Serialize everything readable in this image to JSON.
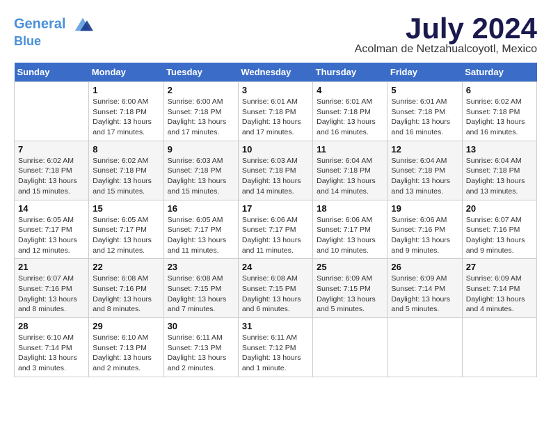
{
  "header": {
    "logo_line1": "General",
    "logo_line2": "Blue",
    "month": "July 2024",
    "location": "Acolman de Netzahualcoyotl, Mexico"
  },
  "days_of_week": [
    "Sunday",
    "Monday",
    "Tuesday",
    "Wednesday",
    "Thursday",
    "Friday",
    "Saturday"
  ],
  "weeks": [
    [
      {
        "num": "",
        "info": ""
      },
      {
        "num": "1",
        "info": "Sunrise: 6:00 AM\nSunset: 7:18 PM\nDaylight: 13 hours\nand 17 minutes."
      },
      {
        "num": "2",
        "info": "Sunrise: 6:00 AM\nSunset: 7:18 PM\nDaylight: 13 hours\nand 17 minutes."
      },
      {
        "num": "3",
        "info": "Sunrise: 6:01 AM\nSunset: 7:18 PM\nDaylight: 13 hours\nand 17 minutes."
      },
      {
        "num": "4",
        "info": "Sunrise: 6:01 AM\nSunset: 7:18 PM\nDaylight: 13 hours\nand 16 minutes."
      },
      {
        "num": "5",
        "info": "Sunrise: 6:01 AM\nSunset: 7:18 PM\nDaylight: 13 hours\nand 16 minutes."
      },
      {
        "num": "6",
        "info": "Sunrise: 6:02 AM\nSunset: 7:18 PM\nDaylight: 13 hours\nand 16 minutes."
      }
    ],
    [
      {
        "num": "7",
        "info": "Sunrise: 6:02 AM\nSunset: 7:18 PM\nDaylight: 13 hours\nand 15 minutes."
      },
      {
        "num": "8",
        "info": "Sunrise: 6:02 AM\nSunset: 7:18 PM\nDaylight: 13 hours\nand 15 minutes."
      },
      {
        "num": "9",
        "info": "Sunrise: 6:03 AM\nSunset: 7:18 PM\nDaylight: 13 hours\nand 15 minutes."
      },
      {
        "num": "10",
        "info": "Sunrise: 6:03 AM\nSunset: 7:18 PM\nDaylight: 13 hours\nand 14 minutes."
      },
      {
        "num": "11",
        "info": "Sunrise: 6:04 AM\nSunset: 7:18 PM\nDaylight: 13 hours\nand 14 minutes."
      },
      {
        "num": "12",
        "info": "Sunrise: 6:04 AM\nSunset: 7:18 PM\nDaylight: 13 hours\nand 13 minutes."
      },
      {
        "num": "13",
        "info": "Sunrise: 6:04 AM\nSunset: 7:18 PM\nDaylight: 13 hours\nand 13 minutes."
      }
    ],
    [
      {
        "num": "14",
        "info": "Sunrise: 6:05 AM\nSunset: 7:17 PM\nDaylight: 13 hours\nand 12 minutes."
      },
      {
        "num": "15",
        "info": "Sunrise: 6:05 AM\nSunset: 7:17 PM\nDaylight: 13 hours\nand 12 minutes."
      },
      {
        "num": "16",
        "info": "Sunrise: 6:05 AM\nSunset: 7:17 PM\nDaylight: 13 hours\nand 11 minutes."
      },
      {
        "num": "17",
        "info": "Sunrise: 6:06 AM\nSunset: 7:17 PM\nDaylight: 13 hours\nand 11 minutes."
      },
      {
        "num": "18",
        "info": "Sunrise: 6:06 AM\nSunset: 7:17 PM\nDaylight: 13 hours\nand 10 minutes."
      },
      {
        "num": "19",
        "info": "Sunrise: 6:06 AM\nSunset: 7:16 PM\nDaylight: 13 hours\nand 9 minutes."
      },
      {
        "num": "20",
        "info": "Sunrise: 6:07 AM\nSunset: 7:16 PM\nDaylight: 13 hours\nand 9 minutes."
      }
    ],
    [
      {
        "num": "21",
        "info": "Sunrise: 6:07 AM\nSunset: 7:16 PM\nDaylight: 13 hours\nand 8 minutes."
      },
      {
        "num": "22",
        "info": "Sunrise: 6:08 AM\nSunset: 7:16 PM\nDaylight: 13 hours\nand 8 minutes."
      },
      {
        "num": "23",
        "info": "Sunrise: 6:08 AM\nSunset: 7:15 PM\nDaylight: 13 hours\nand 7 minutes."
      },
      {
        "num": "24",
        "info": "Sunrise: 6:08 AM\nSunset: 7:15 PM\nDaylight: 13 hours\nand 6 minutes."
      },
      {
        "num": "25",
        "info": "Sunrise: 6:09 AM\nSunset: 7:15 PM\nDaylight: 13 hours\nand 5 minutes."
      },
      {
        "num": "26",
        "info": "Sunrise: 6:09 AM\nSunset: 7:14 PM\nDaylight: 13 hours\nand 5 minutes."
      },
      {
        "num": "27",
        "info": "Sunrise: 6:09 AM\nSunset: 7:14 PM\nDaylight: 13 hours\nand 4 minutes."
      }
    ],
    [
      {
        "num": "28",
        "info": "Sunrise: 6:10 AM\nSunset: 7:14 PM\nDaylight: 13 hours\nand 3 minutes."
      },
      {
        "num": "29",
        "info": "Sunrise: 6:10 AM\nSunset: 7:13 PM\nDaylight: 13 hours\nand 2 minutes."
      },
      {
        "num": "30",
        "info": "Sunrise: 6:11 AM\nSunset: 7:13 PM\nDaylight: 13 hours\nand 2 minutes."
      },
      {
        "num": "31",
        "info": "Sunrise: 6:11 AM\nSunset: 7:12 PM\nDaylight: 13 hours\nand 1 minute."
      },
      {
        "num": "",
        "info": ""
      },
      {
        "num": "",
        "info": ""
      },
      {
        "num": "",
        "info": ""
      }
    ]
  ]
}
